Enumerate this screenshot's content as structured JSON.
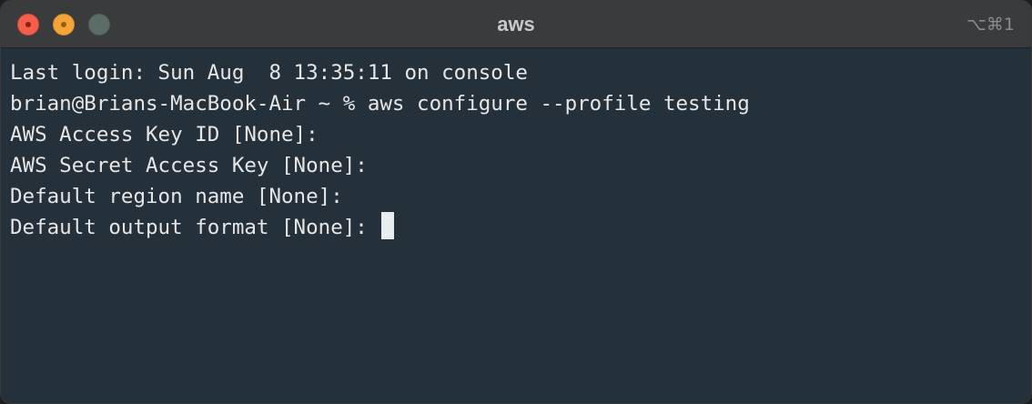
{
  "window": {
    "title": "aws",
    "shortcut": "⌥⌘1"
  },
  "terminal": {
    "lines": [
      "Last login: Sun Aug  8 13:35:11 on console",
      "brian@Brians-MacBook-Air ~ % aws configure --profile testing",
      "AWS Access Key ID [None]:",
      "AWS Secret Access Key [None]:",
      "Default region name [None]:",
      "Default output format [None]: "
    ]
  },
  "colors": {
    "terminal_background": "#25313a",
    "text": "#e6e6e6",
    "titlebar": "#3a3b3d",
    "close_button": "#f25f4c",
    "minimize_button": "#f4a53a",
    "maximize_button": "#5b6d66"
  }
}
